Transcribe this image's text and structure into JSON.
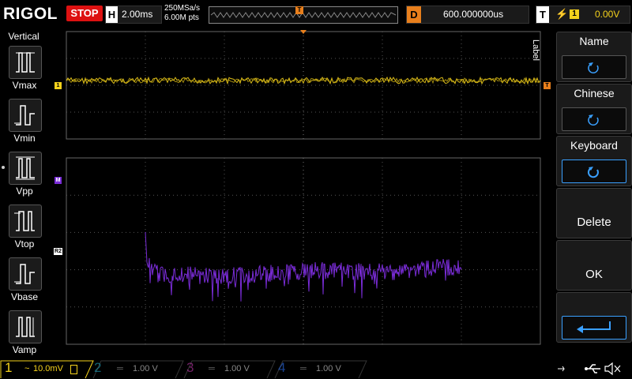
{
  "brand": "RIGOL",
  "run_state": "STOP",
  "horizontal": {
    "label": "H",
    "timebase": "2.00ms"
  },
  "acquisition": {
    "sample_rate": "250MSa/s",
    "memory_depth": "6.00M pts"
  },
  "trigger_marker": "T",
  "delay": {
    "label": "D",
    "value": "600.000000us"
  },
  "trigger": {
    "label": "T",
    "slope": "⚡",
    "source": "1",
    "level": "0.00V"
  },
  "left_menu": {
    "title": "Vertical",
    "items": [
      {
        "label": "Vmax",
        "icon": "vmax-icon"
      },
      {
        "label": "Vmin",
        "icon": "vmin-icon"
      },
      {
        "label": "Vpp",
        "icon": "vpp-icon"
      },
      {
        "label": "Vtop",
        "icon": "vtop-icon"
      },
      {
        "label": "Vbase",
        "icon": "vbase-icon"
      },
      {
        "label": "Vamp",
        "icon": "vamp-icon"
      }
    ]
  },
  "right_menu": {
    "tab": "Label",
    "items": [
      {
        "label": "Name",
        "icon": "rotate-icon"
      },
      {
        "label": "Chinese",
        "icon": "rotate-icon"
      },
      {
        "label": "Keyboard",
        "icon": "rotate-icon"
      },
      {
        "label": "Delete"
      },
      {
        "label": "OK"
      },
      {
        "label": "",
        "icon": "enter-icon"
      }
    ]
  },
  "traces": {
    "ch1_marker": "1",
    "math_marker": "M",
    "ref_marker": "R2",
    "trig_level_marker": "T"
  },
  "channels": [
    {
      "num": "1",
      "coupling": "~",
      "scale": "10.0mV",
      "color": "#f5d21c"
    },
    {
      "num": "2",
      "scale": "1.00 V",
      "color": "#1fbfe0"
    },
    {
      "num": "3",
      "scale": "1.00 V",
      "color": "#e040c8"
    },
    {
      "num": "4",
      "scale": "1.00 V",
      "color": "#2a6ff0"
    }
  ],
  "colors": {
    "ch1": "#f5d21c",
    "math": "#7a2cd8",
    "trigger": "#e87f1c",
    "grid": "#404040"
  }
}
